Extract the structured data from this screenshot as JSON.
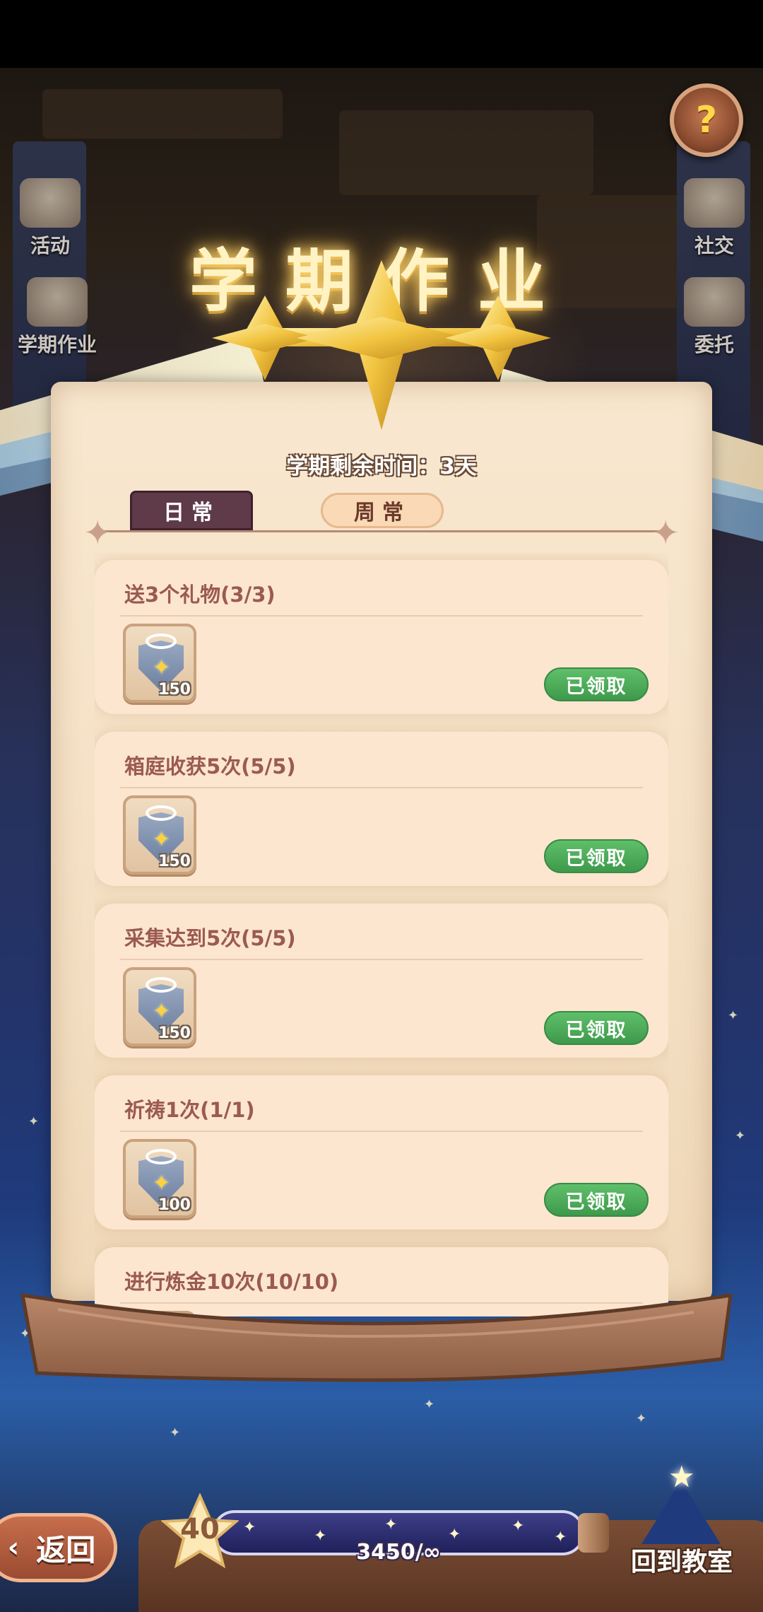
{
  "header": {
    "title": "学期作业",
    "remaining_label": "学期剩余时间：3天",
    "help_icon": "question-icon"
  },
  "side_menu": {
    "left": [
      {
        "label": "活动",
        "icon": "event-icon"
      },
      {
        "label": "学期作业",
        "icon": "homework-icon"
      }
    ],
    "right": [
      {
        "label": "社交",
        "icon": "social-icon"
      },
      {
        "label": "委托",
        "icon": "commission-icon"
      }
    ]
  },
  "tabs": [
    {
      "label": "日常",
      "active": true
    },
    {
      "label": "周常",
      "active": false
    }
  ],
  "tasks": [
    {
      "title": "送3个礼物(3/3)",
      "reward_amount": "150",
      "button_label": "已领取"
    },
    {
      "title": "箱庭收获5次(5/5)",
      "reward_amount": "150",
      "button_label": "已领取"
    },
    {
      "title": "采集达到5次(5/5)",
      "reward_amount": "150",
      "button_label": "已领取"
    },
    {
      "title": "祈祷1次(1/1)",
      "reward_amount": "100",
      "button_label": "已领取"
    },
    {
      "title": "进行炼金10次(10/10)",
      "reward_amount": "",
      "button_label": ""
    }
  ],
  "footer": {
    "back_label": "返回",
    "level": "40",
    "xp_text": "3450/∞",
    "classroom_label": "回到教室"
  },
  "colors": {
    "claimed_green": "#4aac57",
    "active_tab": "#5f3a48",
    "task_title": "#9a5a52",
    "paper": "#f8e7cf"
  }
}
